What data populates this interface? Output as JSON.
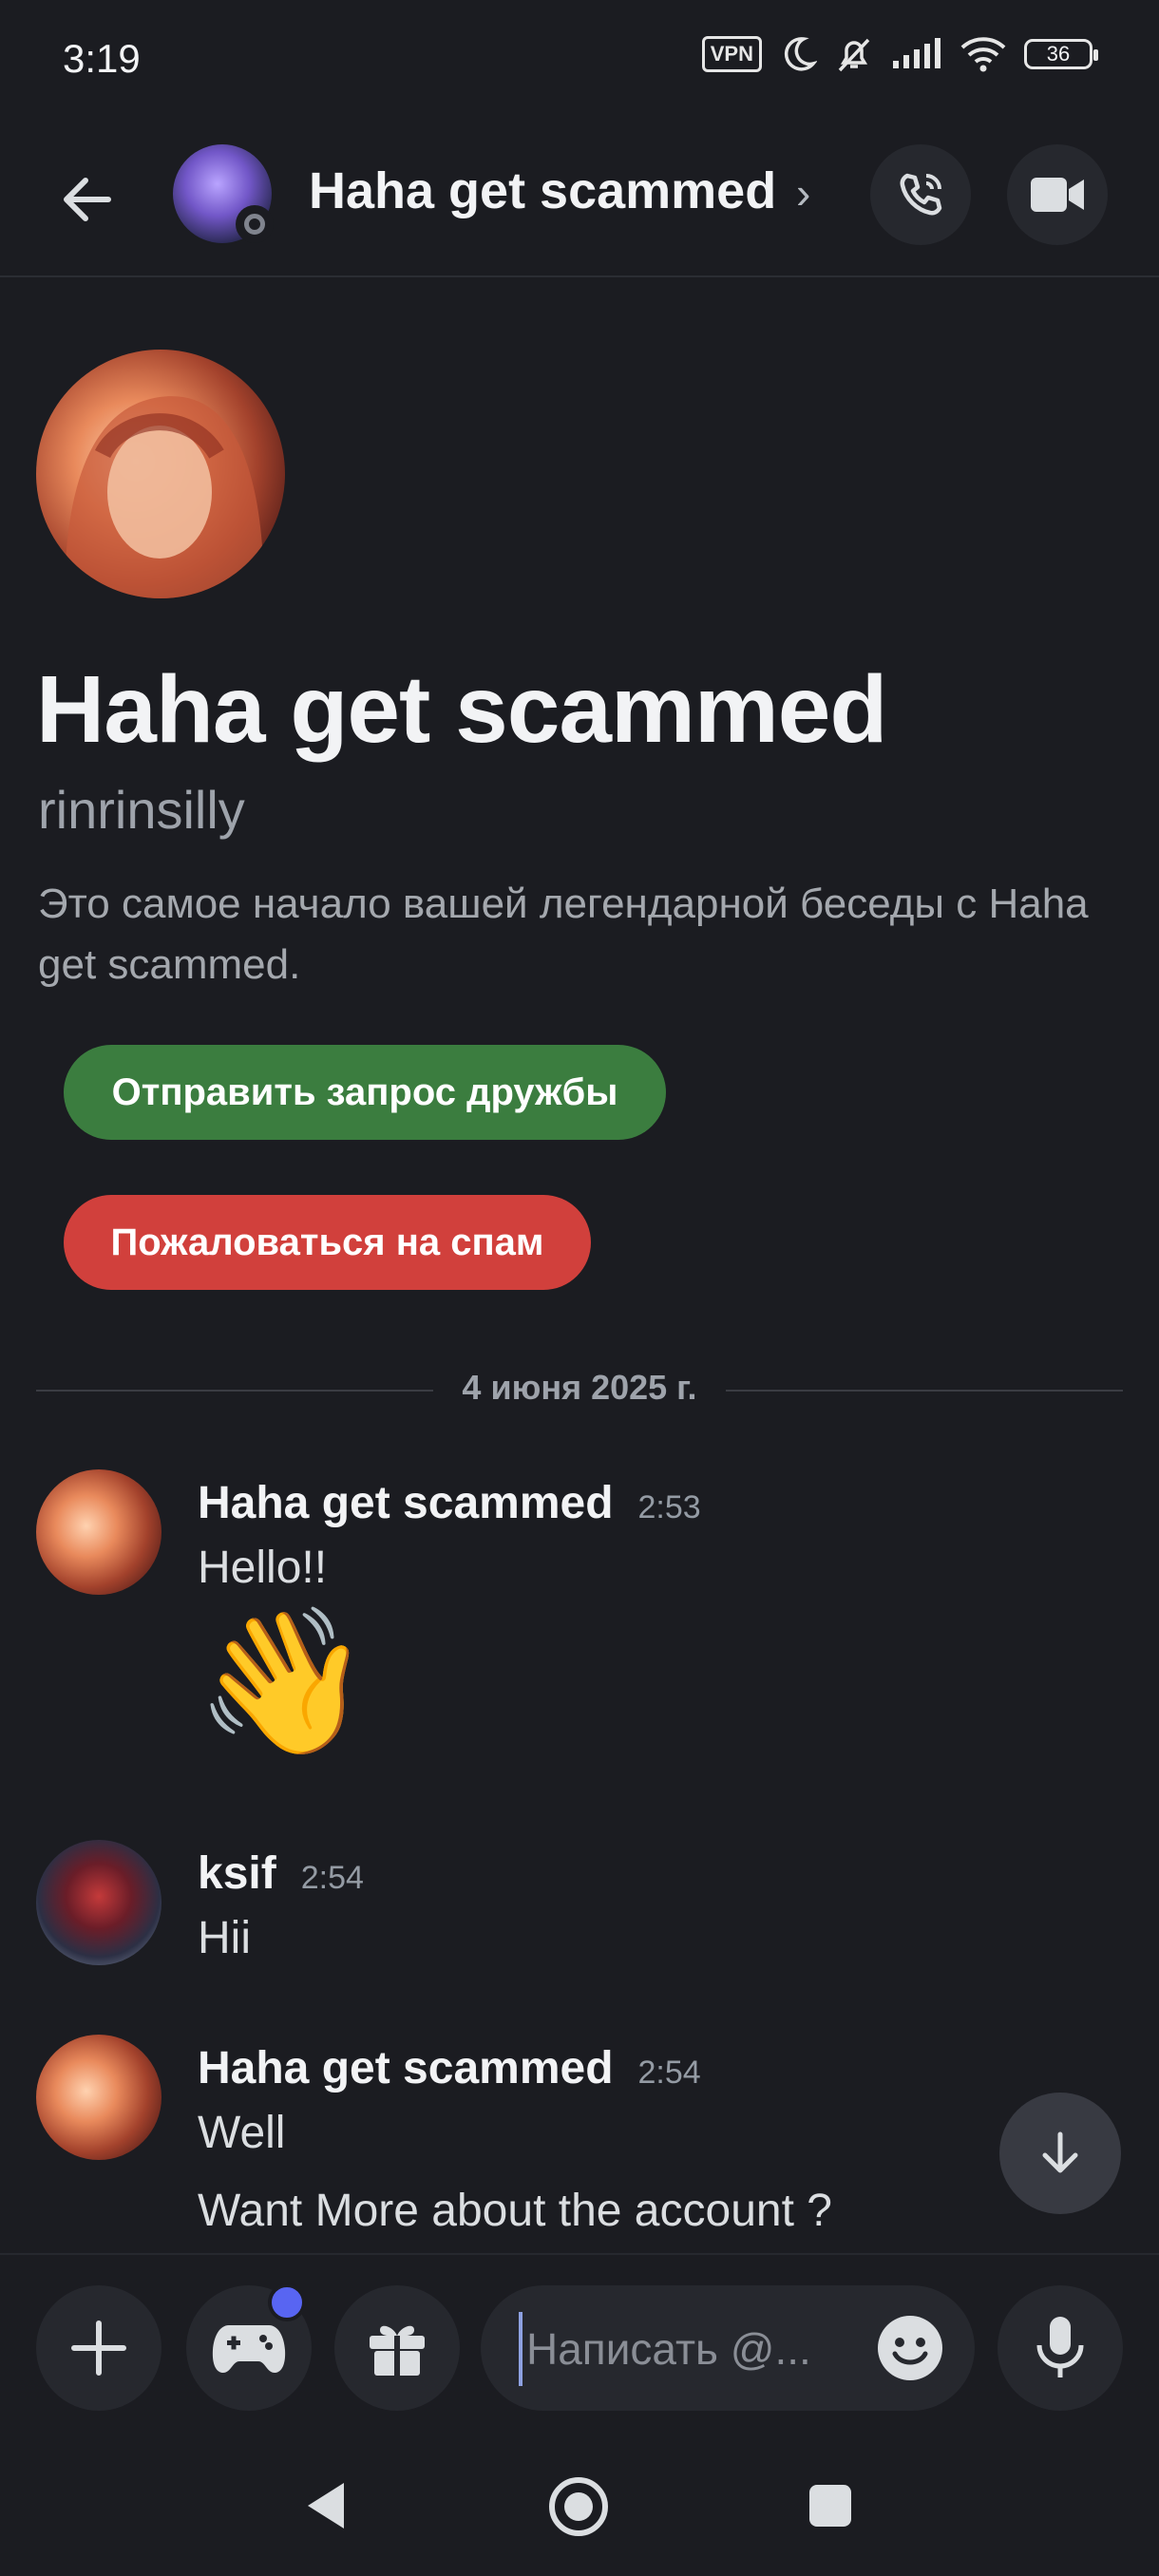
{
  "status_bar": {
    "time": "3:19",
    "vpn": "VPN",
    "battery": "36"
  },
  "header": {
    "title": "Haha get scammed"
  },
  "intro": {
    "title": "Haha get scammed",
    "username": "rinrinsilly",
    "description": "Это самое начало вашей легендарной беседы с Haha get scammed.",
    "friend_request_label": "Отправить запрос дружбы",
    "report_spam_label": "Пожаловаться на спам"
  },
  "date_divider": "4 июня 2025 г.",
  "messages": [
    {
      "author": "Haha get scammed",
      "time": "2:53",
      "lines": [
        "Hello!!"
      ],
      "emoji": "👋"
    },
    {
      "author": "ksif",
      "time": "2:54",
      "lines": [
        "Hii"
      ]
    },
    {
      "author": "Haha get scammed",
      "time": "2:54",
      "lines": [
        "Well",
        "Want More about the account ?"
      ]
    }
  ],
  "composer": {
    "placeholder": "Написать @..."
  },
  "colors": {
    "background": "#1b1c21",
    "friend_button": "#3b7d3f",
    "spam_button": "#d1403c",
    "notification_dot": "#5865f2"
  }
}
